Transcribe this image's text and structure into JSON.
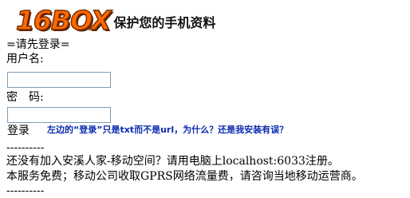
{
  "logo": {
    "mark": "16BOX",
    "slogan": "保护您的手机资料"
  },
  "login_prompt": "=请先登录=",
  "username": {
    "label": "用户名:",
    "value": ""
  },
  "password": {
    "label": "密　码:",
    "value": ""
  },
  "login_link": "登录",
  "note": "左边的“登录”只是txt而不是url，为什么？还是我安装有误？",
  "separator": "----------",
  "info": {
    "line1": "还没有加入安溪人家-移动空间？请用电脑上localhost:6033注册。",
    "line2": "本服务免费；移动公司收取GPRS网络流量费，请咨询当地移动运营商。"
  },
  "colors": {
    "logo_orange": "#ff6a00",
    "note_blue": "#0b2bb0",
    "input_border": "#7f9db9"
  }
}
